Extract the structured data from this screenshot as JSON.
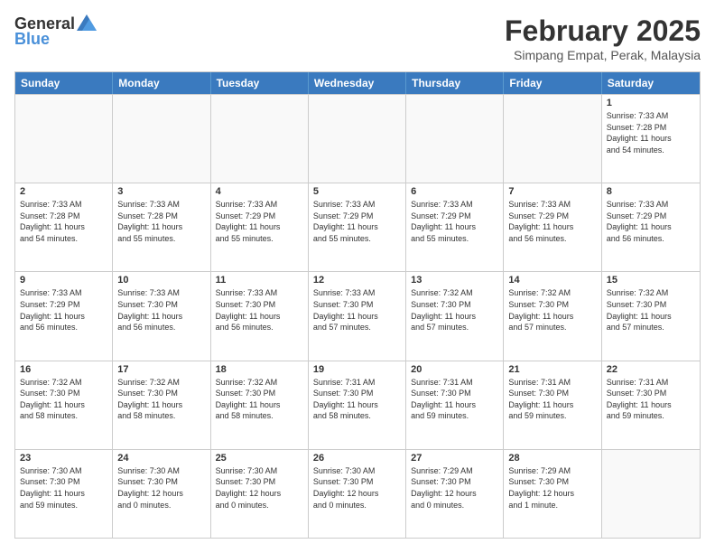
{
  "header": {
    "logo_general": "General",
    "logo_blue": "Blue",
    "month_year": "February 2025",
    "location": "Simpang Empat, Perak, Malaysia"
  },
  "weekdays": [
    "Sunday",
    "Monday",
    "Tuesday",
    "Wednesday",
    "Thursday",
    "Friday",
    "Saturday"
  ],
  "weeks": [
    [
      {
        "day": "",
        "info": ""
      },
      {
        "day": "",
        "info": ""
      },
      {
        "day": "",
        "info": ""
      },
      {
        "day": "",
        "info": ""
      },
      {
        "day": "",
        "info": ""
      },
      {
        "day": "",
        "info": ""
      },
      {
        "day": "1",
        "info": "Sunrise: 7:33 AM\nSunset: 7:28 PM\nDaylight: 11 hours\nand 54 minutes."
      }
    ],
    [
      {
        "day": "2",
        "info": "Sunrise: 7:33 AM\nSunset: 7:28 PM\nDaylight: 11 hours\nand 54 minutes."
      },
      {
        "day": "3",
        "info": "Sunrise: 7:33 AM\nSunset: 7:28 PM\nDaylight: 11 hours\nand 55 minutes."
      },
      {
        "day": "4",
        "info": "Sunrise: 7:33 AM\nSunset: 7:29 PM\nDaylight: 11 hours\nand 55 minutes."
      },
      {
        "day": "5",
        "info": "Sunrise: 7:33 AM\nSunset: 7:29 PM\nDaylight: 11 hours\nand 55 minutes."
      },
      {
        "day": "6",
        "info": "Sunrise: 7:33 AM\nSunset: 7:29 PM\nDaylight: 11 hours\nand 55 minutes."
      },
      {
        "day": "7",
        "info": "Sunrise: 7:33 AM\nSunset: 7:29 PM\nDaylight: 11 hours\nand 56 minutes."
      },
      {
        "day": "8",
        "info": "Sunrise: 7:33 AM\nSunset: 7:29 PM\nDaylight: 11 hours\nand 56 minutes."
      }
    ],
    [
      {
        "day": "9",
        "info": "Sunrise: 7:33 AM\nSunset: 7:29 PM\nDaylight: 11 hours\nand 56 minutes."
      },
      {
        "day": "10",
        "info": "Sunrise: 7:33 AM\nSunset: 7:30 PM\nDaylight: 11 hours\nand 56 minutes."
      },
      {
        "day": "11",
        "info": "Sunrise: 7:33 AM\nSunset: 7:30 PM\nDaylight: 11 hours\nand 56 minutes."
      },
      {
        "day": "12",
        "info": "Sunrise: 7:33 AM\nSunset: 7:30 PM\nDaylight: 11 hours\nand 57 minutes."
      },
      {
        "day": "13",
        "info": "Sunrise: 7:32 AM\nSunset: 7:30 PM\nDaylight: 11 hours\nand 57 minutes."
      },
      {
        "day": "14",
        "info": "Sunrise: 7:32 AM\nSunset: 7:30 PM\nDaylight: 11 hours\nand 57 minutes."
      },
      {
        "day": "15",
        "info": "Sunrise: 7:32 AM\nSunset: 7:30 PM\nDaylight: 11 hours\nand 57 minutes."
      }
    ],
    [
      {
        "day": "16",
        "info": "Sunrise: 7:32 AM\nSunset: 7:30 PM\nDaylight: 11 hours\nand 58 minutes."
      },
      {
        "day": "17",
        "info": "Sunrise: 7:32 AM\nSunset: 7:30 PM\nDaylight: 11 hours\nand 58 minutes."
      },
      {
        "day": "18",
        "info": "Sunrise: 7:32 AM\nSunset: 7:30 PM\nDaylight: 11 hours\nand 58 minutes."
      },
      {
        "day": "19",
        "info": "Sunrise: 7:31 AM\nSunset: 7:30 PM\nDaylight: 11 hours\nand 58 minutes."
      },
      {
        "day": "20",
        "info": "Sunrise: 7:31 AM\nSunset: 7:30 PM\nDaylight: 11 hours\nand 59 minutes."
      },
      {
        "day": "21",
        "info": "Sunrise: 7:31 AM\nSunset: 7:30 PM\nDaylight: 11 hours\nand 59 minutes."
      },
      {
        "day": "22",
        "info": "Sunrise: 7:31 AM\nSunset: 7:30 PM\nDaylight: 11 hours\nand 59 minutes."
      }
    ],
    [
      {
        "day": "23",
        "info": "Sunrise: 7:30 AM\nSunset: 7:30 PM\nDaylight: 11 hours\nand 59 minutes."
      },
      {
        "day": "24",
        "info": "Sunrise: 7:30 AM\nSunset: 7:30 PM\nDaylight: 12 hours\nand 0 minutes."
      },
      {
        "day": "25",
        "info": "Sunrise: 7:30 AM\nSunset: 7:30 PM\nDaylight: 12 hours\nand 0 minutes."
      },
      {
        "day": "26",
        "info": "Sunrise: 7:30 AM\nSunset: 7:30 PM\nDaylight: 12 hours\nand 0 minutes."
      },
      {
        "day": "27",
        "info": "Sunrise: 7:29 AM\nSunset: 7:30 PM\nDaylight: 12 hours\nand 0 minutes."
      },
      {
        "day": "28",
        "info": "Sunrise: 7:29 AM\nSunset: 7:30 PM\nDaylight: 12 hours\nand 1 minute."
      },
      {
        "day": "",
        "info": ""
      }
    ]
  ]
}
